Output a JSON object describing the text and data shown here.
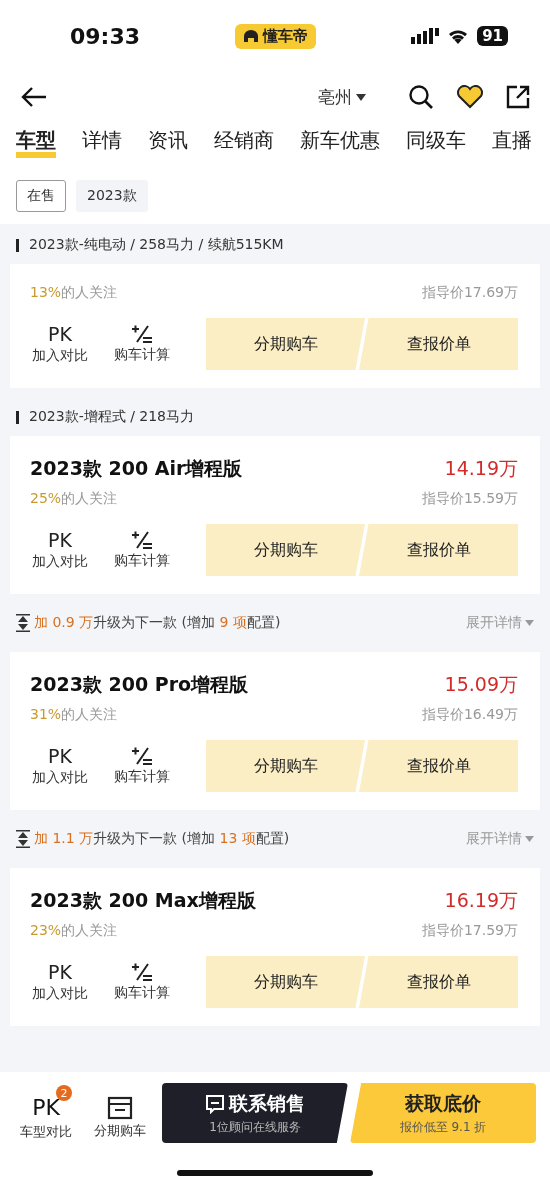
{
  "status_bar": {
    "time": "09:33",
    "app_badge": "懂车帝",
    "battery": "91"
  },
  "nav": {
    "city": "亳州",
    "favorited": true
  },
  "tabs": [
    {
      "label": "车型",
      "selected": true
    },
    {
      "label": "详情",
      "selected": false
    },
    {
      "label": "资讯",
      "selected": false
    },
    {
      "label": "经销商",
      "selected": false
    },
    {
      "label": "新车优惠",
      "selected": false
    },
    {
      "label": "同级车",
      "selected": false
    },
    {
      "label": "直播",
      "selected": false
    }
  ],
  "filters": [
    {
      "label": "在售",
      "selected": true
    },
    {
      "label": "2023款",
      "selected": false
    }
  ],
  "groups": [
    {
      "header": "2023款-纯电动 / 258马力 / 续航515KM",
      "items": [
        {
          "kind": "card",
          "share": "13%",
          "share_label": "的人关注",
          "guide_price": "指导价17.69万",
          "pk": "PK",
          "compare": "加入对比",
          "calc": "购车计算",
          "loan": "分期购车",
          "quote": "查报价单"
        }
      ]
    },
    {
      "header": "2023款-增程式 / 218马力",
      "items": [
        {
          "kind": "card",
          "title": "2023款 200 Air增程版",
          "price": "14.19万",
          "share": "25%",
          "share_label": "的人关注",
          "guide_price": "指导价15.59万",
          "pk": "PK",
          "compare": "加入对比",
          "calc": "购车计算",
          "loan": "分期购车",
          "quote": "查报价单"
        },
        {
          "kind": "upgrade",
          "parts": [
            {
              "text": "加 0.9 万",
              "highlight": true
            },
            {
              "text": "升级为下一款 (增加 ",
              "highlight": false
            },
            {
              "text": "9 项",
              "highlight": true
            },
            {
              "text": "配置)",
              "highlight": false
            }
          ],
          "expand": "展开详情"
        },
        {
          "kind": "card",
          "title": "2023款 200 Pro增程版",
          "price": "15.09万",
          "share": "31%",
          "share_label": "的人关注",
          "guide_price": "指导价16.49万",
          "pk": "PK",
          "compare": "加入对比",
          "calc": "购车计算",
          "loan": "分期购车",
          "quote": "查报价单"
        },
        {
          "kind": "upgrade",
          "parts": [
            {
              "text": "加 1.1 万",
              "highlight": true
            },
            {
              "text": "升级为下一款 (增加 ",
              "highlight": false
            },
            {
              "text": "13 项",
              "highlight": true
            },
            {
              "text": "配置)",
              "highlight": false
            }
          ],
          "expand": "展开详情"
        },
        {
          "kind": "card",
          "title": "2023款 200 Max增程版",
          "price": "16.19万",
          "share": "23%",
          "share_label": "的人关注",
          "guide_price": "指导价17.59万",
          "pk": "PK",
          "compare": "加入对比",
          "calc": "购车计算",
          "loan": "分期购车",
          "quote": "查报价单"
        }
      ]
    }
  ],
  "bottom_bar": {
    "pk": "PK",
    "pk_count": "2",
    "compare": "车型对比",
    "loan": "分期购车",
    "contact": "联系销售",
    "contact_sub": "1位顾问在线服务",
    "lowest": "获取底价",
    "lowest_sub": "报价低至 9.1 折"
  }
}
